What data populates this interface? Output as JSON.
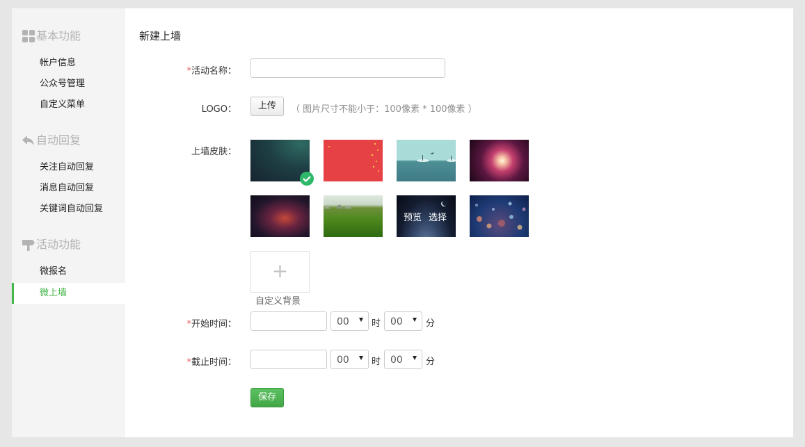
{
  "sidebar": {
    "sections": [
      {
        "title": "基本功能",
        "icon": "grid-icon",
        "items": [
          "帐户信息",
          "公众号管理",
          "自定义菜单"
        ]
      },
      {
        "title": "自动回复",
        "icon": "reply-arrow-icon",
        "items": [
          "关注自动回复",
          "消息自动回复",
          "关键词自动回复"
        ]
      },
      {
        "title": "活动功能",
        "icon": "signpost-icon",
        "items": [
          "微报名",
          "微上墙"
        ]
      }
    ],
    "active_item": "微上墙"
  },
  "form": {
    "title": "新建上墙",
    "required_mark": "*",
    "activity_name_label": "活动名称：",
    "activity_name_value": "",
    "logo_label": "LOGO：",
    "upload_button": "上传",
    "logo_hint": "（ 图片尺寸不能小于：100像素 * 100像素 ）",
    "skin_label": "上墙皮肤：",
    "skins": [
      "teal-gradient",
      "red-confetti",
      "sea-islands",
      "purple-burst",
      "dark-nebula",
      "green-field",
      "earth-space",
      "blue-bokeh"
    ],
    "selected_skin": 0,
    "hovered_skin": 6,
    "hover_actions": {
      "preview": "预览",
      "select": "选择"
    },
    "custom_bg_plus": "+",
    "custom_bg_label": "自定义背景",
    "start_time_label": "开始时间：",
    "end_time_label": "截止时间：",
    "start_date_value": "",
    "end_date_value": "",
    "start_hour": "00",
    "start_minute": "00",
    "end_hour": "00",
    "end_minute": "00",
    "hour_unit": "时",
    "minute_unit": "分",
    "save_button": "保存"
  },
  "colors": {
    "accent": "#44b549",
    "required": "#e15f63",
    "sidebar_bg": "#f4f4f4",
    "page_bg": "#e6e6e6"
  }
}
